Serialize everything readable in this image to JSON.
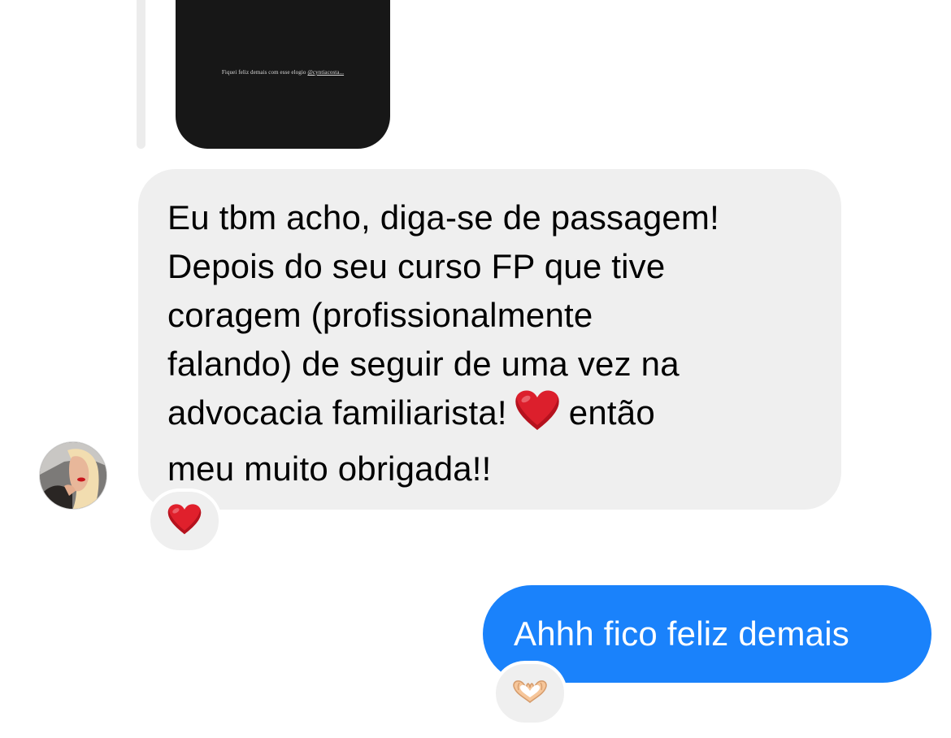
{
  "story_reply": {
    "caption_text": "Fiquei feliz demais com esse elogio",
    "caption_mention": "@cyntiacosta..."
  },
  "incoming_message": {
    "sender_avatar_icon": "profile-photo",
    "lines": [
      "Eu tbm acho, diga-se de passagem!",
      "Depois do seu curso FP que tive",
      "coragem (profissionalmente",
      "falando) de seguir de uma vez na"
    ],
    "line5_before_emoji": "advocacia familiarista!",
    "inline_emoji": "red-heart-icon",
    "line5_after_emoji": "então",
    "line6": "meu muito obrigada!!",
    "reaction_icon": "red-heart-icon"
  },
  "outgoing_message": {
    "text": "Ahhh fico feliz demais",
    "reaction_icon": "heart-hands-icon"
  },
  "colors": {
    "incoming_bubble": "#efefef",
    "outgoing_bubble": "#1a82fb",
    "heart": "#e0202c",
    "story_background": "#171717"
  }
}
